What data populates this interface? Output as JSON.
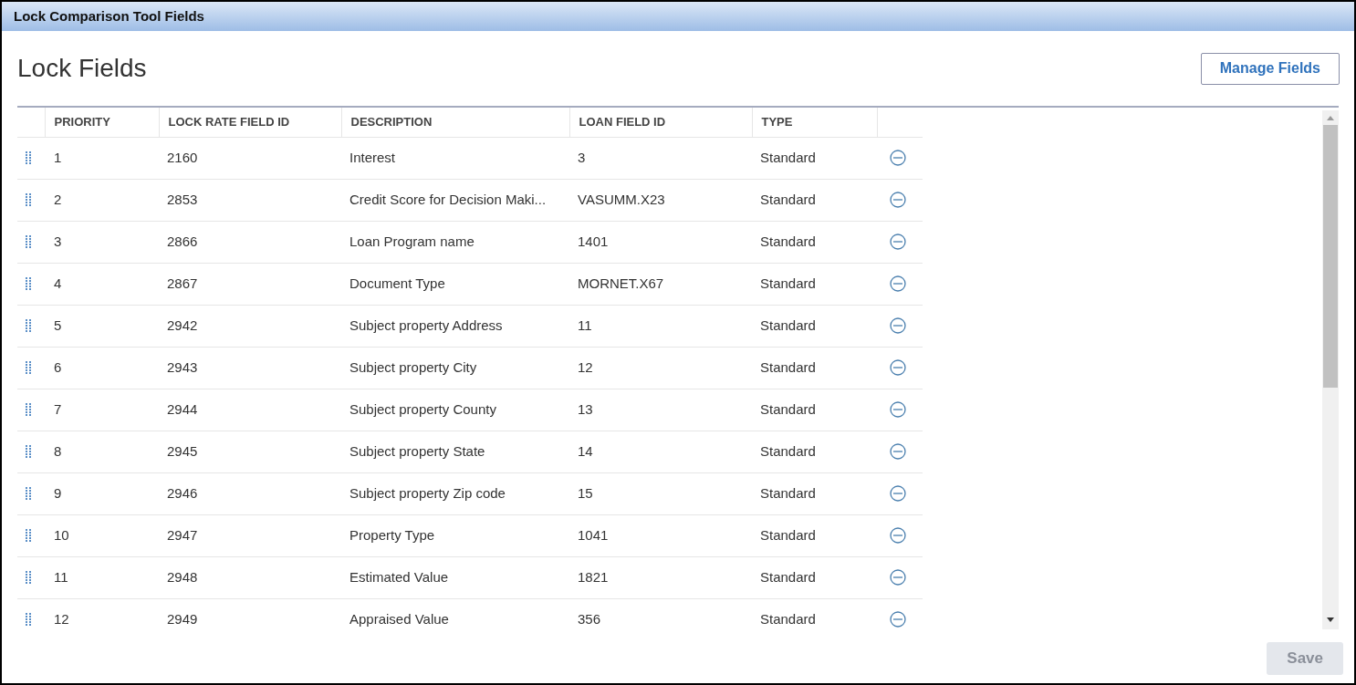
{
  "window": {
    "title": "Lock Comparison Tool Fields"
  },
  "heading": "Lock Fields",
  "manage_button": "Manage Fields",
  "table": {
    "columns": [
      "PRIORITY",
      "LOCK RATE FIELD ID",
      "DESCRIPTION",
      "LOAN FIELD ID",
      "TYPE"
    ],
    "rows": [
      {
        "priority": "1",
        "lock_rate_field_id": "2160",
        "description": "Interest",
        "loan_field_id": "3",
        "type": "Standard"
      },
      {
        "priority": "2",
        "lock_rate_field_id": "2853",
        "description": "Credit Score for Decision Maki...",
        "loan_field_id": "VASUMM.X23",
        "type": "Standard"
      },
      {
        "priority": "3",
        "lock_rate_field_id": "2866",
        "description": "Loan Program name",
        "loan_field_id": "1401",
        "type": "Standard"
      },
      {
        "priority": "4",
        "lock_rate_field_id": "2867",
        "description": "Document Type",
        "loan_field_id": "MORNET.X67",
        "type": "Standard"
      },
      {
        "priority": "5",
        "lock_rate_field_id": "2942",
        "description": "Subject property Address",
        "loan_field_id": "11",
        "type": "Standard"
      },
      {
        "priority": "6",
        "lock_rate_field_id": "2943",
        "description": "Subject property City",
        "loan_field_id": "12",
        "type": "Standard"
      },
      {
        "priority": "7",
        "lock_rate_field_id": "2944",
        "description": "Subject property County",
        "loan_field_id": "13",
        "type": "Standard"
      },
      {
        "priority": "8",
        "lock_rate_field_id": "2945",
        "description": "Subject property State",
        "loan_field_id": "14",
        "type": "Standard"
      },
      {
        "priority": "9",
        "lock_rate_field_id": "2946",
        "description": "Subject property Zip code",
        "loan_field_id": "15",
        "type": "Standard"
      },
      {
        "priority": "10",
        "lock_rate_field_id": "2947",
        "description": "Property Type",
        "loan_field_id": "1041",
        "type": "Standard"
      },
      {
        "priority": "11",
        "lock_rate_field_id": "2948",
        "description": "Estimated Value",
        "loan_field_id": "1821",
        "type": "Standard"
      },
      {
        "priority": "12",
        "lock_rate_field_id": "2949",
        "description": "Appraised Value",
        "loan_field_id": "356",
        "type": "Standard"
      }
    ]
  },
  "save_button": {
    "label": "Save",
    "disabled": true
  }
}
